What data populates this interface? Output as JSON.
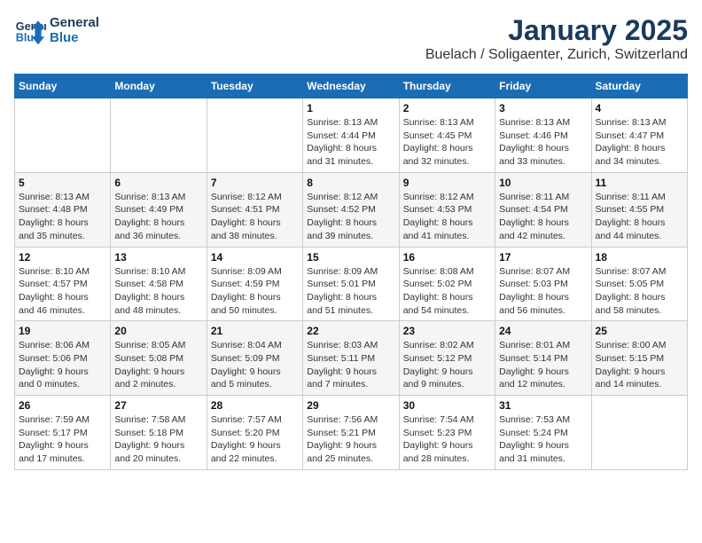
{
  "logo": {
    "line1": "General",
    "line2": "Blue"
  },
  "title": "January 2025",
  "location": "Buelach / Soligaenter, Zurich, Switzerland",
  "weekdays": [
    "Sunday",
    "Monday",
    "Tuesday",
    "Wednesday",
    "Thursday",
    "Friday",
    "Saturday"
  ],
  "weeks": [
    [
      {
        "day": "",
        "info": ""
      },
      {
        "day": "",
        "info": ""
      },
      {
        "day": "",
        "info": ""
      },
      {
        "day": "1",
        "info": "Sunrise: 8:13 AM\nSunset: 4:44 PM\nDaylight: 8 hours\nand 31 minutes."
      },
      {
        "day": "2",
        "info": "Sunrise: 8:13 AM\nSunset: 4:45 PM\nDaylight: 8 hours\nand 32 minutes."
      },
      {
        "day": "3",
        "info": "Sunrise: 8:13 AM\nSunset: 4:46 PM\nDaylight: 8 hours\nand 33 minutes."
      },
      {
        "day": "4",
        "info": "Sunrise: 8:13 AM\nSunset: 4:47 PM\nDaylight: 8 hours\nand 34 minutes."
      }
    ],
    [
      {
        "day": "5",
        "info": "Sunrise: 8:13 AM\nSunset: 4:48 PM\nDaylight: 8 hours\nand 35 minutes."
      },
      {
        "day": "6",
        "info": "Sunrise: 8:13 AM\nSunset: 4:49 PM\nDaylight: 8 hours\nand 36 minutes."
      },
      {
        "day": "7",
        "info": "Sunrise: 8:12 AM\nSunset: 4:51 PM\nDaylight: 8 hours\nand 38 minutes."
      },
      {
        "day": "8",
        "info": "Sunrise: 8:12 AM\nSunset: 4:52 PM\nDaylight: 8 hours\nand 39 minutes."
      },
      {
        "day": "9",
        "info": "Sunrise: 8:12 AM\nSunset: 4:53 PM\nDaylight: 8 hours\nand 41 minutes."
      },
      {
        "day": "10",
        "info": "Sunrise: 8:11 AM\nSunset: 4:54 PM\nDaylight: 8 hours\nand 42 minutes."
      },
      {
        "day": "11",
        "info": "Sunrise: 8:11 AM\nSunset: 4:55 PM\nDaylight: 8 hours\nand 44 minutes."
      }
    ],
    [
      {
        "day": "12",
        "info": "Sunrise: 8:10 AM\nSunset: 4:57 PM\nDaylight: 8 hours\nand 46 minutes."
      },
      {
        "day": "13",
        "info": "Sunrise: 8:10 AM\nSunset: 4:58 PM\nDaylight: 8 hours\nand 48 minutes."
      },
      {
        "day": "14",
        "info": "Sunrise: 8:09 AM\nSunset: 4:59 PM\nDaylight: 8 hours\nand 50 minutes."
      },
      {
        "day": "15",
        "info": "Sunrise: 8:09 AM\nSunset: 5:01 PM\nDaylight: 8 hours\nand 51 minutes."
      },
      {
        "day": "16",
        "info": "Sunrise: 8:08 AM\nSunset: 5:02 PM\nDaylight: 8 hours\nand 54 minutes."
      },
      {
        "day": "17",
        "info": "Sunrise: 8:07 AM\nSunset: 5:03 PM\nDaylight: 8 hours\nand 56 minutes."
      },
      {
        "day": "18",
        "info": "Sunrise: 8:07 AM\nSunset: 5:05 PM\nDaylight: 8 hours\nand 58 minutes."
      }
    ],
    [
      {
        "day": "19",
        "info": "Sunrise: 8:06 AM\nSunset: 5:06 PM\nDaylight: 9 hours\nand 0 minutes."
      },
      {
        "day": "20",
        "info": "Sunrise: 8:05 AM\nSunset: 5:08 PM\nDaylight: 9 hours\nand 2 minutes."
      },
      {
        "day": "21",
        "info": "Sunrise: 8:04 AM\nSunset: 5:09 PM\nDaylight: 9 hours\nand 5 minutes."
      },
      {
        "day": "22",
        "info": "Sunrise: 8:03 AM\nSunset: 5:11 PM\nDaylight: 9 hours\nand 7 minutes."
      },
      {
        "day": "23",
        "info": "Sunrise: 8:02 AM\nSunset: 5:12 PM\nDaylight: 9 hours\nand 9 minutes."
      },
      {
        "day": "24",
        "info": "Sunrise: 8:01 AM\nSunset: 5:14 PM\nDaylight: 9 hours\nand 12 minutes."
      },
      {
        "day": "25",
        "info": "Sunrise: 8:00 AM\nSunset: 5:15 PM\nDaylight: 9 hours\nand 14 minutes."
      }
    ],
    [
      {
        "day": "26",
        "info": "Sunrise: 7:59 AM\nSunset: 5:17 PM\nDaylight: 9 hours\nand 17 minutes."
      },
      {
        "day": "27",
        "info": "Sunrise: 7:58 AM\nSunset: 5:18 PM\nDaylight: 9 hours\nand 20 minutes."
      },
      {
        "day": "28",
        "info": "Sunrise: 7:57 AM\nSunset: 5:20 PM\nDaylight: 9 hours\nand 22 minutes."
      },
      {
        "day": "29",
        "info": "Sunrise: 7:56 AM\nSunset: 5:21 PM\nDaylight: 9 hours\nand 25 minutes."
      },
      {
        "day": "30",
        "info": "Sunrise: 7:54 AM\nSunset: 5:23 PM\nDaylight: 9 hours\nand 28 minutes."
      },
      {
        "day": "31",
        "info": "Sunrise: 7:53 AM\nSunset: 5:24 PM\nDaylight: 9 hours\nand 31 minutes."
      },
      {
        "day": "",
        "info": ""
      }
    ]
  ]
}
